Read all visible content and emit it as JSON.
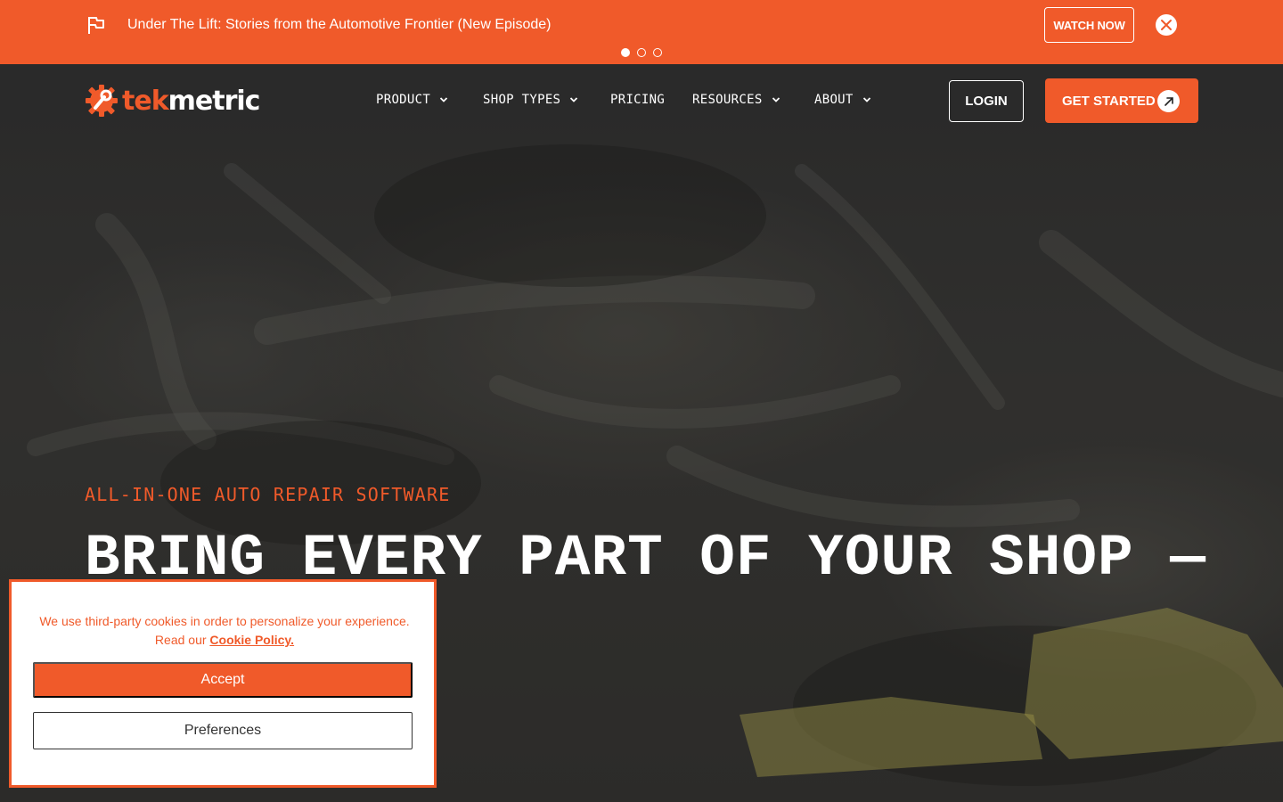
{
  "announcement": {
    "message": "Under The Lift: Stories from the Automotive Frontier (New Episode)",
    "cta_label": "WATCH NOW",
    "slides_total": 3,
    "slide_active": 1
  },
  "brand": {
    "logo_part1": "tek",
    "logo_part2": "metric",
    "accent_color": "#f05a2a"
  },
  "nav": {
    "items": [
      {
        "label": "PRODUCT",
        "has_dropdown": true
      },
      {
        "label": "SHOP TYPES",
        "has_dropdown": true
      },
      {
        "label": "PRICING",
        "has_dropdown": false
      },
      {
        "label": "RESOURCES",
        "has_dropdown": true
      },
      {
        "label": "ABOUT",
        "has_dropdown": true
      }
    ],
    "login_label": "LOGIN",
    "get_started_label": "GET STARTED"
  },
  "hero": {
    "eyebrow": "ALL-IN-ONE AUTO REPAIR SOFTWARE",
    "headline": "BRING EVERY PART OF YOUR SHOP —"
  },
  "cookie": {
    "text_line1": "We use third-party cookies in order to personalize your experience.",
    "text_line2_prefix": "Read our ",
    "policy_link": "Cookie Policy.",
    "accept_label": "Accept",
    "preferences_label": "Preferences"
  },
  "icons": {
    "announcement": "flag-icon",
    "close": "close-icon",
    "dropdown": "chevron-down-icon",
    "cta": "arrow-up-right-icon",
    "logo": "gear-wrench-icon"
  }
}
